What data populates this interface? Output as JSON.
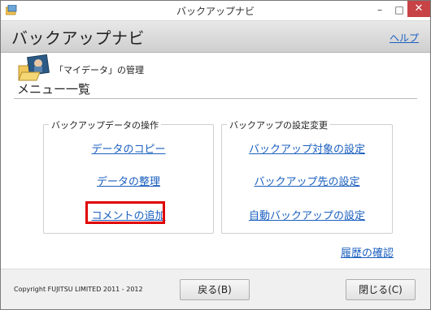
{
  "window": {
    "title": "バックアップナビ",
    "minimize_glyph": "–",
    "maximize_glyph": "□",
    "close_glyph": "✕"
  },
  "header": {
    "title": "バックアップナビ",
    "help_label": "ヘルプ"
  },
  "section": {
    "subtitle": "「マイデータ」の管理",
    "title": "メニュー一覧"
  },
  "groups": {
    "left": {
      "legend": "バックアップデータの操作",
      "links": [
        "データのコピー",
        "データの整理",
        "コメントの追加"
      ]
    },
    "right": {
      "legend": "バックアップの設定変更",
      "links": [
        "バックアップ対象の設定",
        "バックアップ先の設定",
        "自動バックアップの設定"
      ]
    }
  },
  "history_label": "履歴の確認",
  "footer": {
    "copyright": "Copyright FUJITSU LIMITED 2011 - 2012",
    "back_label": "戻る(B)",
    "close_label": "閉じる(C)"
  },
  "colors": {
    "link": "#1a5fbf",
    "highlight": "#e00000",
    "close_button": "#c74346"
  },
  "icons": {
    "app": "app-icon",
    "data": "folder-photo-icon"
  }
}
